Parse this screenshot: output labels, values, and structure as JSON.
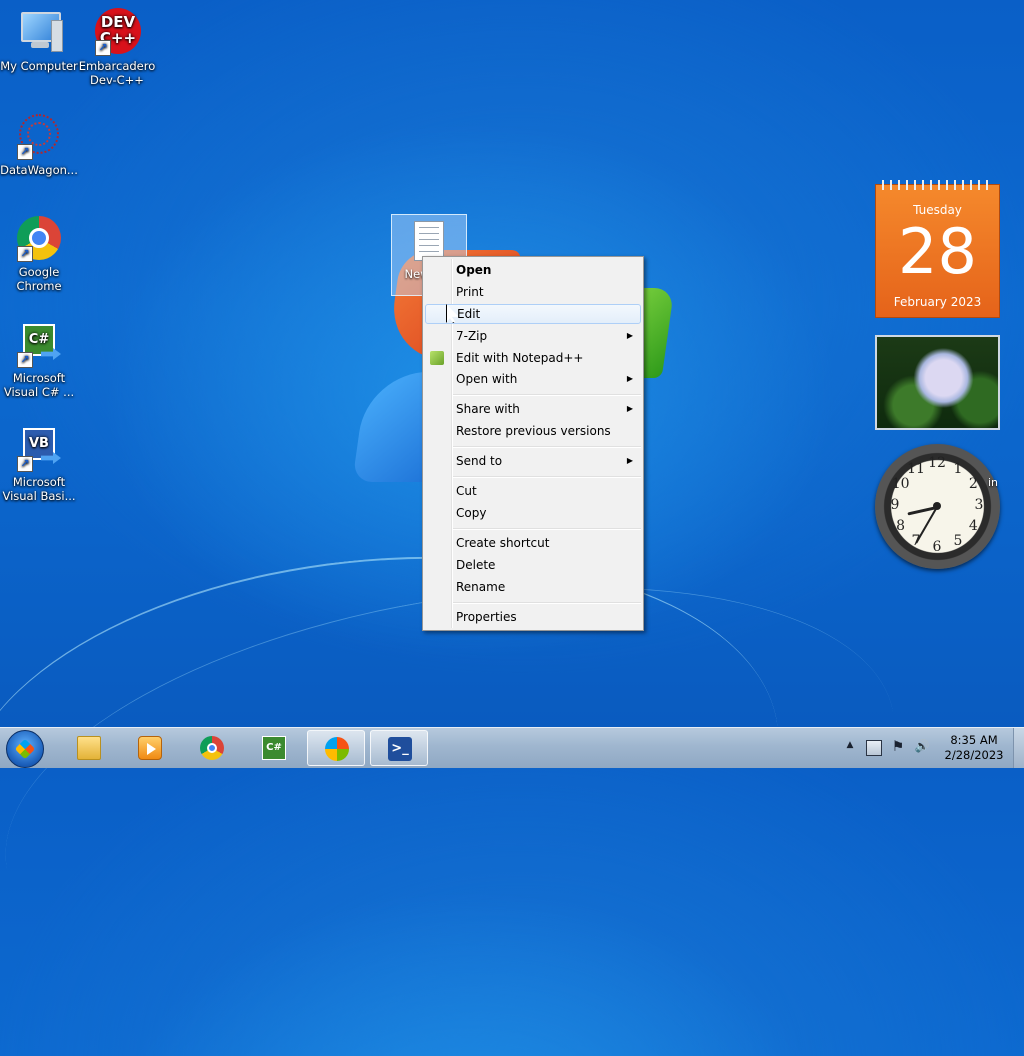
{
  "desktop": {
    "icons": [
      {
        "label": "My Computer",
        "icon": "computer-icon"
      },
      {
        "label": "Embarcadero Dev-C++",
        "icon": "devcpp-icon",
        "badge": "DEV C++"
      },
      {
        "label": "DataWagon...",
        "icon": "datawagon-icon"
      },
      {
        "label": "Google Chrome",
        "icon": "chrome-icon"
      },
      {
        "label": "Microsoft Visual C# ...",
        "icon": "visual-csharp-icon",
        "badge": "C#"
      },
      {
        "label": "Microsoft Visual Basi...",
        "icon": "visual-basic-icon",
        "badge": "VB"
      }
    ],
    "selected_file": {
      "label": "New Doc",
      "icon": "text-document-icon"
    }
  },
  "context_menu": {
    "items": [
      {
        "label": "Open",
        "bold": true
      },
      {
        "label": "Print"
      },
      {
        "label": "Edit",
        "hover": true
      },
      {
        "label": "7-Zip",
        "submenu": true
      },
      {
        "label": "Edit with Notepad++",
        "icon": "notepadpp-icon"
      },
      {
        "label": "Open with",
        "submenu": true
      },
      {
        "label": "Share with",
        "submenu": true
      },
      {
        "label": "Restore previous versions"
      },
      {
        "label": "Send to",
        "submenu": true
      },
      {
        "label": "Cut"
      },
      {
        "label": "Copy"
      },
      {
        "label": "Create shortcut"
      },
      {
        "label": "Delete"
      },
      {
        "label": "Rename"
      },
      {
        "label": "Properties"
      }
    ],
    "submenu_glyph": "▶"
  },
  "gadgets": {
    "calendar": {
      "weekday": "Tuesday",
      "day": "28",
      "month_year": "February 2023"
    },
    "clock": {
      "numbers": [
        "12",
        "1",
        "2",
        "3",
        "4",
        "5",
        "6",
        "7",
        "8",
        "9",
        "10",
        "11"
      ],
      "hour": 8,
      "minute": 35
    },
    "side_text": "in"
  },
  "taskbar": {
    "start_icon": "windows-start-icon",
    "pinned": [
      {
        "name": "explorer",
        "icon": "folder-icon"
      },
      {
        "name": "media-player",
        "icon": "media-player-icon"
      },
      {
        "name": "chrome",
        "icon": "chrome-icon"
      },
      {
        "name": "visual-csharp",
        "icon": "visual-csharp-icon",
        "text": "C#"
      },
      {
        "name": "windows-app",
        "icon": "windows-logo-icon",
        "active": true
      },
      {
        "name": "powershell",
        "icon": "powershell-icon",
        "text": ">_",
        "active": true
      }
    ],
    "tray": {
      "time": "8:35 AM",
      "date": "2/28/2023",
      "up_arrow": "▲",
      "flag": "⚑",
      "volume": "🔊"
    }
  }
}
